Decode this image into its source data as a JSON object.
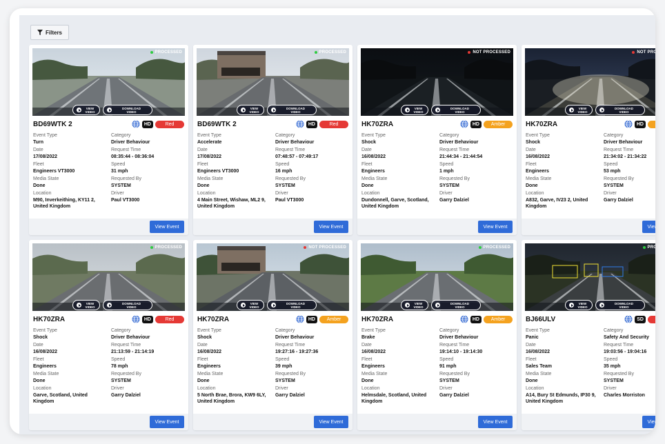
{
  "toolbar": {
    "filters_label": "Filters"
  },
  "video_buttons": {
    "view_1": "VIEW",
    "view_2": "VIDEO",
    "download_1": "DOWNLOAD",
    "download_2": "VIDEO"
  },
  "labels": {
    "event_type": "Event Type",
    "category": "Category",
    "date": "Date",
    "request_time": "Request Time",
    "fleet": "Fleet",
    "speed": "Speed",
    "media_state": "Media State",
    "requested_by": "Requested By",
    "location": "Location",
    "driver": "Driver"
  },
  "view_event_label": "View Event",
  "colors": {
    "red": "#e53935",
    "amber": "#f4a21f",
    "accent": "#2f6bd8",
    "processed": "#2ecc40",
    "not_processed": "#e53935"
  },
  "cards": [
    {
      "status": "PROCESSED",
      "processed": true,
      "reg": "BD69WTK 2",
      "quality": "HD",
      "severity": "Red",
      "event_type": "Turn",
      "category": "Driver Behaviour",
      "date": "17/08/2022",
      "request_time": "08:35:44 - 08:36:04",
      "fleet": "Engineers VT3000",
      "speed": "31 mph",
      "media_state": "Done",
      "requested_by": "SYSTEM",
      "location": "M90, Inverkeithing, KY11 2, United Kingdom",
      "driver": "Paul VT3000",
      "scene": "road-day"
    },
    {
      "status": "PROCESSED",
      "processed": true,
      "reg": "BD69WTK 2",
      "quality": "HD",
      "severity": "Red",
      "event_type": "Accelerate",
      "category": "Driver Behaviour",
      "date": "17/08/2022",
      "request_time": "07:48:57 - 07:49:17",
      "fleet": "Engineers VT3000",
      "speed": "16 mph",
      "media_state": "Done",
      "requested_by": "SYSTEM",
      "location": "4 Main Street, Wishaw, ML2 9, United Kingdom",
      "driver": "Paul VT3000",
      "scene": "town"
    },
    {
      "status": "NOT PROCESSED",
      "processed": false,
      "reg": "HK70ZRA",
      "quality": "HD",
      "severity": "Amber",
      "event_type": "Shock",
      "category": "Driver Behaviour",
      "date": "16/08/2022",
      "request_time": "21:44:34 - 21:44:54",
      "fleet": "Engineers",
      "speed": "1 mph",
      "media_state": "Done",
      "requested_by": "SYSTEM",
      "location": "Dundonnell, Garve, Scotland, United Kingdom",
      "driver": "Garry Dalziel",
      "scene": "dark"
    },
    {
      "status": "NOT PROCESSED",
      "processed": false,
      "reg": "HK70ZRA",
      "quality": "HD",
      "severity": "Amber",
      "event_type": "Shock",
      "category": "Driver Behaviour",
      "date": "16/08/2022",
      "request_time": "21:34:02 - 21:34:22",
      "fleet": "Engineers",
      "speed": "53 mph",
      "media_state": "Done",
      "requested_by": "SYSTEM",
      "location": "A832, Garve, IV23 2, United Kingdom",
      "driver": "Garry Dalziel",
      "scene": "night"
    },
    {
      "status": "PROCESSED",
      "processed": true,
      "reg": "HK70ZRA",
      "quality": "HD",
      "severity": "Red",
      "event_type": "Shock",
      "category": "Driver Behaviour",
      "date": "16/08/2022",
      "request_time": "21:13:59 - 21:14:19",
      "fleet": "Engineers",
      "speed": "78 mph",
      "media_state": "Done",
      "requested_by": "SYSTEM",
      "location": "Garve, Scotland, United Kingdom",
      "driver": "Garry Dalziel",
      "scene": "road-grey"
    },
    {
      "status": "NOT PROCESSED",
      "processed": false,
      "reg": "HK70ZRA",
      "quality": "HD",
      "severity": "Amber",
      "event_type": "Shock",
      "category": "Driver Behaviour",
      "date": "16/08/2022",
      "request_time": "19:27:16 - 19:27:36",
      "fleet": "Engineers",
      "speed": "39 mph",
      "media_state": "Done",
      "requested_by": "SYSTEM",
      "location": "5 North Brae, Brora, KW9 6LY, United Kingdom",
      "driver": "Garry Dalziel",
      "scene": "village"
    },
    {
      "status": "PROCESSED",
      "processed": true,
      "reg": "HK70ZRA",
      "quality": "HD",
      "severity": "Amber",
      "event_type": "Brake",
      "category": "Driver Behaviour",
      "date": "16/08/2022",
      "request_time": "19:14:10 - 19:14:30",
      "fleet": "Engineers",
      "speed": "91 mph",
      "media_state": "Done",
      "requested_by": "SYSTEM",
      "location": "Helmsdale, Scotland, United Kingdom",
      "driver": "Garry Dalziel",
      "scene": "road-green"
    },
    {
      "status": "PROCESSED",
      "processed": true,
      "reg": "BJ66ULV",
      "quality": "SD",
      "severity": "Red",
      "event_type": "Panic",
      "category": "Safety And Security",
      "date": "16/08/2022",
      "request_time": "19:03:56 - 19:04:16",
      "fleet": "Sales Team",
      "speed": "35 mph",
      "media_state": "Done",
      "requested_by": "SYSTEM",
      "location": "A14, Bury St Edmunds, IP30 9, United Kingdom",
      "driver": "Charles Morriston",
      "scene": "detection"
    }
  ]
}
